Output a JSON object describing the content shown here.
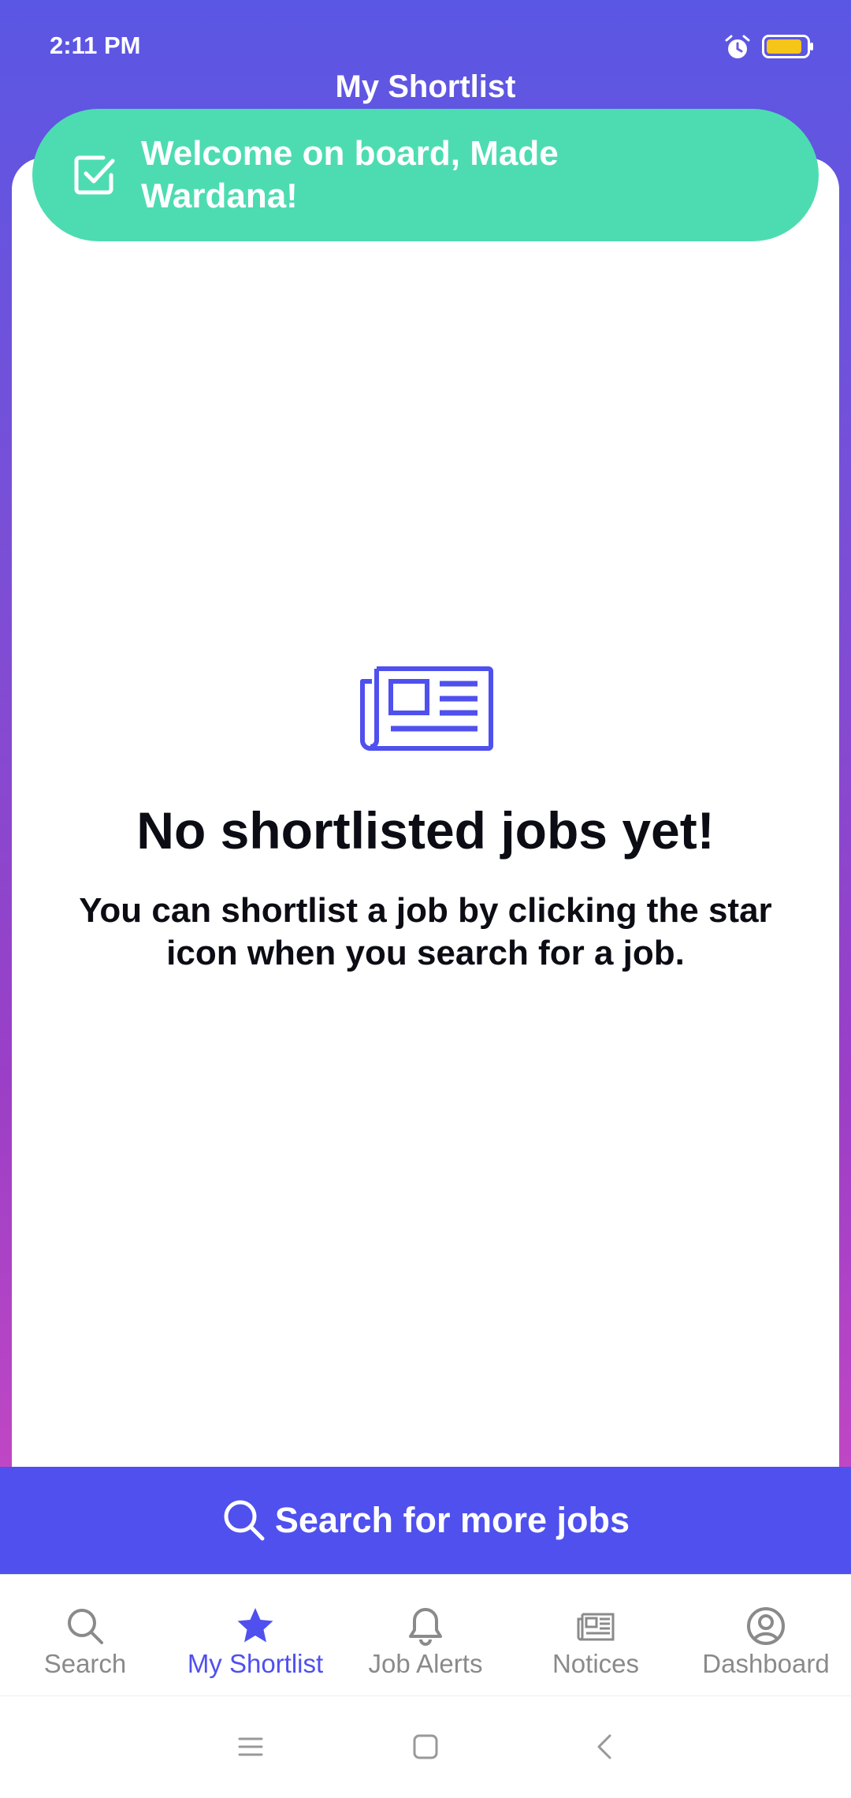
{
  "status_bar": {
    "time": "2:11 PM",
    "icons": [
      "alarm-icon",
      "battery-icon"
    ],
    "battery_color": "#f5c518"
  },
  "header": {
    "title": "My Shortlist"
  },
  "toast": {
    "icon": "check-square-icon",
    "message": "Welcome on board, Made Wardana!",
    "color": "#4ddcb1"
  },
  "empty_state": {
    "icon": "newspaper-icon",
    "title": "No shortlisted jobs yet!",
    "description": "You can shortlist a job by clicking the star icon when you search for a job."
  },
  "search_more": {
    "icon": "search-icon",
    "label": "Search for more jobs",
    "color": "#4f50ee"
  },
  "bottom_nav": {
    "items": [
      {
        "label": "Search",
        "icon": "search-icon",
        "active": false
      },
      {
        "label": "My Shortlist",
        "icon": "star-icon",
        "active": true
      },
      {
        "label": "Job Alerts",
        "icon": "bell-icon",
        "active": false
      },
      {
        "label": "Notices",
        "icon": "newspaper-icon",
        "active": false
      },
      {
        "label": "Dashboard",
        "icon": "user-circle-icon",
        "active": false
      }
    ],
    "active_color": "#4f50ee",
    "inactive_color": "#8a8a8a"
  },
  "system_nav": {
    "buttons": [
      "menu-icon",
      "home-icon",
      "back-icon"
    ]
  }
}
